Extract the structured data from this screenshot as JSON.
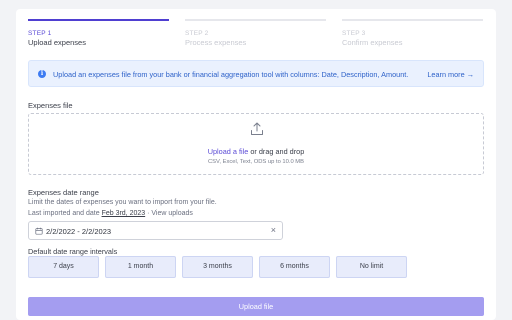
{
  "stepper": [
    {
      "num": "STEP 1",
      "name": "Upload expenses"
    },
    {
      "num": "STEP 2",
      "name": "Process expenses"
    },
    {
      "num": "STEP 3",
      "name": "Confirm expenses"
    }
  ],
  "info": {
    "message": "Upload an expenses file from your bank or financial aggregation tool with columns: Date, Description, Amount.",
    "link": "Learn more →"
  },
  "file": {
    "label": "Expenses file",
    "upload_link": "Upload a file",
    "drag_text": " or drag and drop",
    "hint": "CSV, Excel, Text, ODS up to 10.0 MB"
  },
  "range": {
    "label": "Expenses date range",
    "help": "Limit the dates of expenses you want to import from your file.",
    "last_prefix": "Last imported and date ",
    "last_date": "Feb 3rd, 2023",
    "sep": " · ",
    "view_uploads": "View uploads",
    "value": "2/2/2022  -  2/2/2023"
  },
  "presets": {
    "label": "Default date range intervals",
    "items": [
      "7 days",
      "1 month",
      "3 months",
      "6 months",
      "No limit"
    ]
  },
  "submit": "Upload file"
}
